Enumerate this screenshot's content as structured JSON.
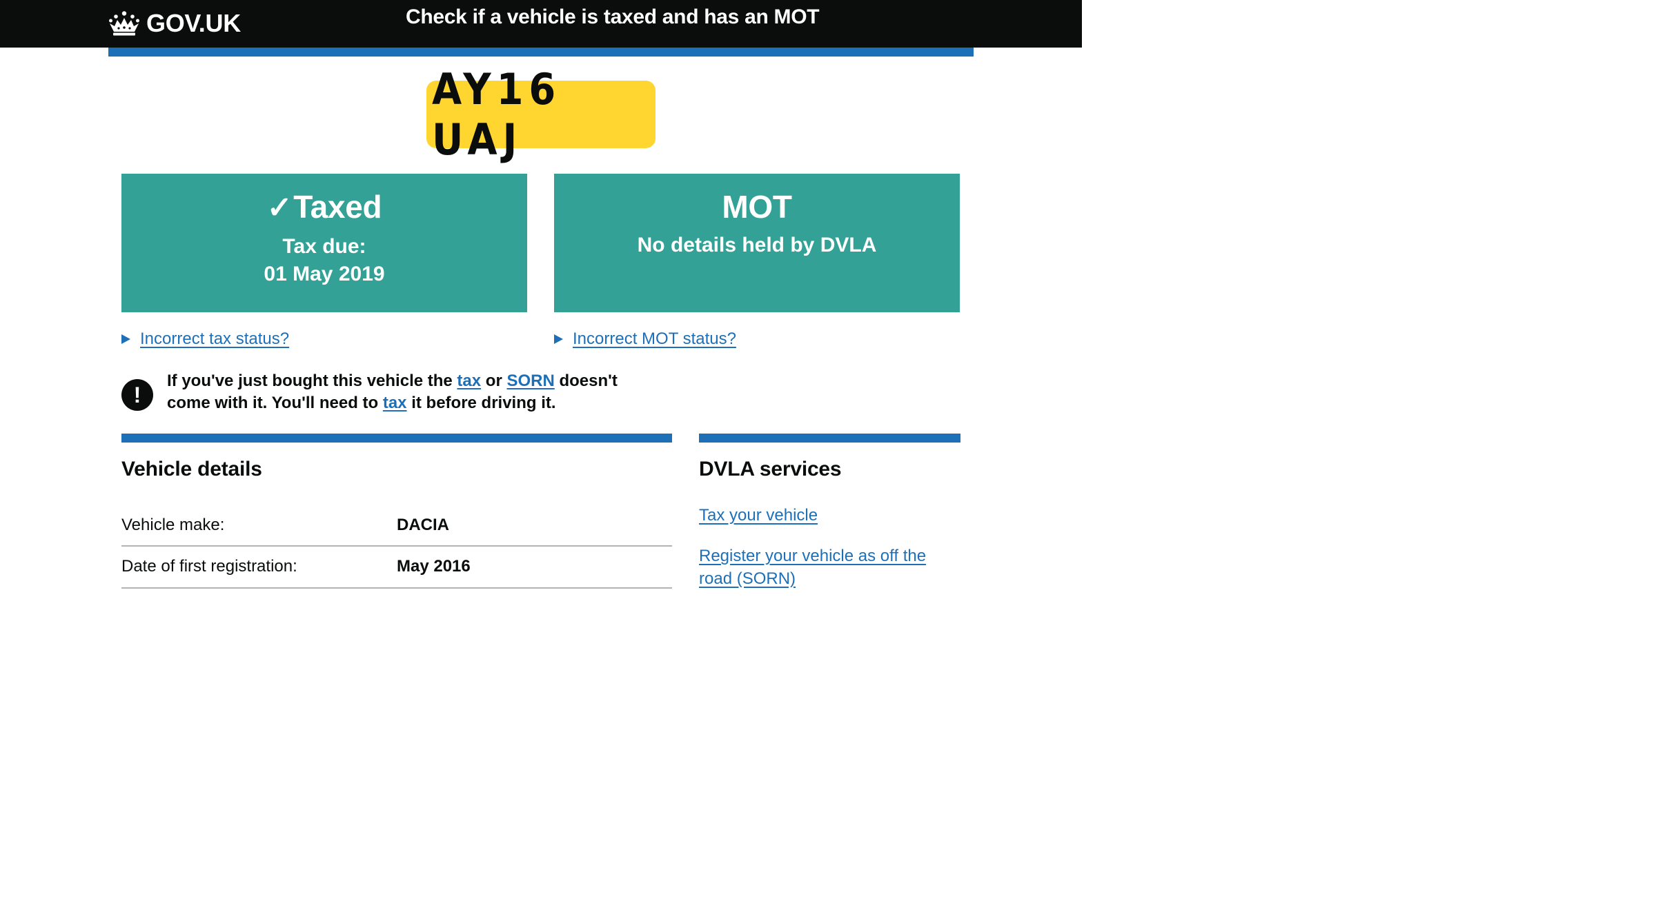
{
  "header": {
    "logo_text": "GOV.UK",
    "service_name": "Check if a vehicle is taxed and has an MOT"
  },
  "vehicle": {
    "registration": "AY16 UAJ"
  },
  "tax_status": {
    "icon": "check-icon",
    "tick": "✓",
    "title": "Taxed",
    "due_label": "Tax due:",
    "due_date": "01 May 2019",
    "toggle_label": "Incorrect tax status?"
  },
  "mot_status": {
    "title": "MOT",
    "detail": "No details held by DVLA",
    "toggle_label": "Incorrect MOT status?"
  },
  "warning": {
    "icon": "!",
    "text_1": "If you've just bought this vehicle the ",
    "link_tax": "tax",
    "text_2": " or ",
    "link_sorn": "SORN",
    "text_3": " doesn't come with it. You'll need to ",
    "link_tax_2": "tax",
    "text_4": " it before driving it."
  },
  "vehicle_details": {
    "title": "Vehicle details",
    "rows": [
      {
        "label": "Vehicle make:",
        "value": "DACIA"
      },
      {
        "label": "Date of first registration:",
        "value": "May 2016"
      }
    ]
  },
  "dvla_services": {
    "title": "DVLA services",
    "links": [
      {
        "label": "Tax your vehicle"
      },
      {
        "label": "Register your vehicle as off the road (SORN)"
      }
    ]
  },
  "colors": {
    "header_bg": "#0b0c0c",
    "brand_blue": "#1d70b8",
    "plate_yellow": "#ffd530",
    "status_green": "#33a196"
  }
}
